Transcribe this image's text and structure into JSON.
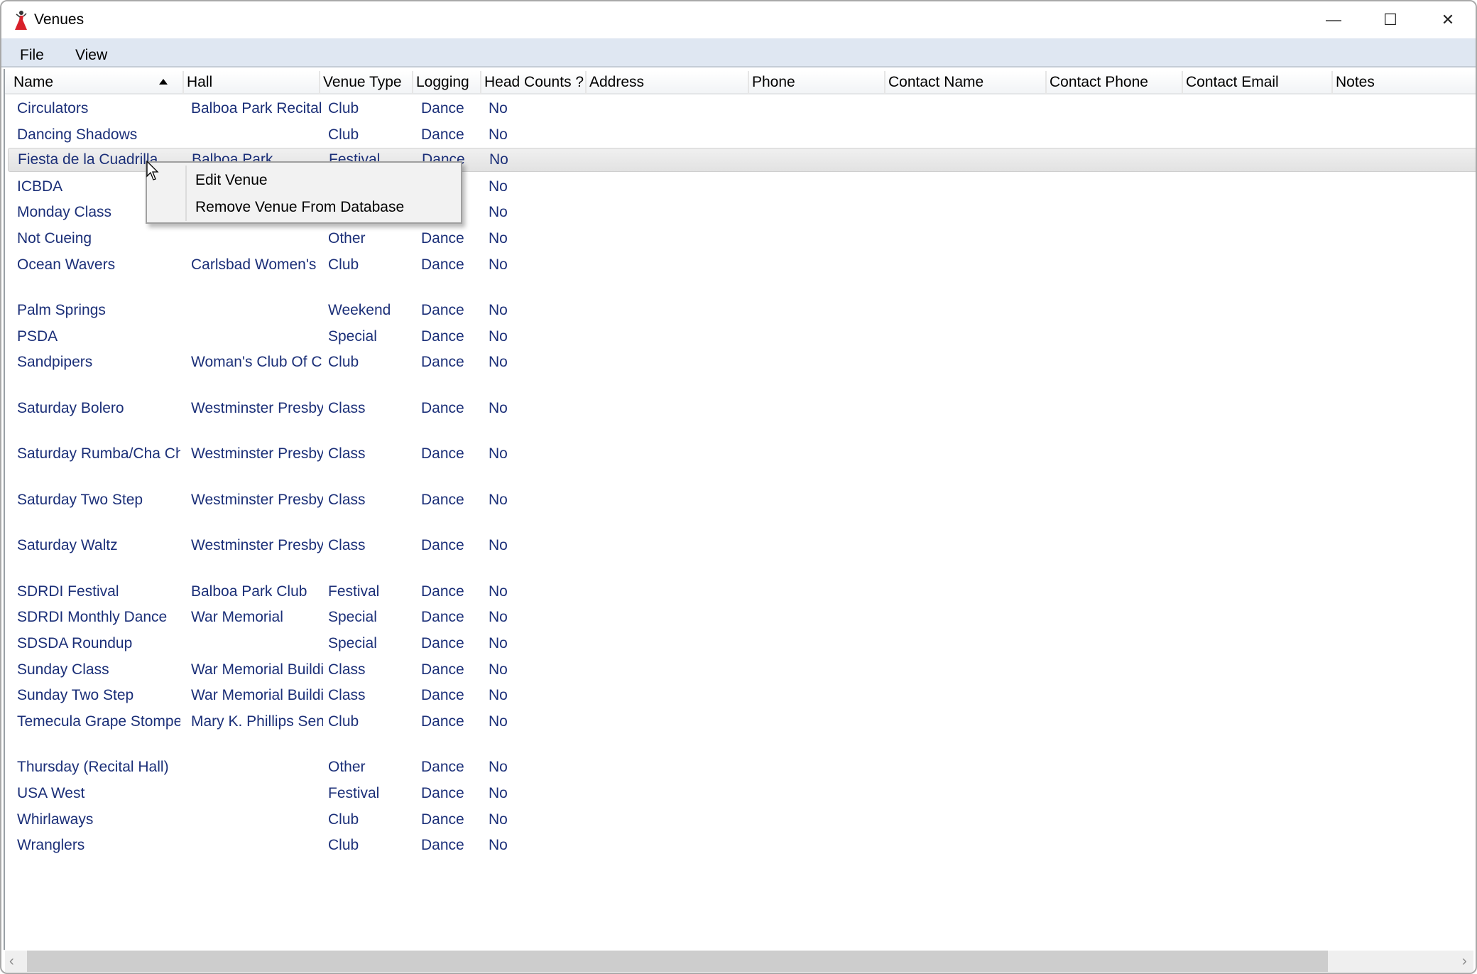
{
  "window": {
    "title": "Venues",
    "app_icon": "red-dancer-icon",
    "controls": {
      "minimize": "—",
      "maximize": "☐",
      "close": "✕"
    }
  },
  "menubar": {
    "items": [
      "File",
      "View"
    ]
  },
  "table": {
    "sort_column": "Name",
    "sort_direction": "ascending",
    "columns": [
      "Name",
      "Hall",
      "Venue Type",
      "Logging",
      "Head Counts ?",
      "Address",
      "Phone",
      "Contact Name",
      "Contact Phone",
      "Contact Email",
      "Notes"
    ],
    "selected_row": "Fiesta de la Cuadrilla",
    "rows": [
      [
        "Circulators",
        "Balboa Park Recital Hall",
        "Club",
        "Dance",
        "No"
      ],
      [
        "Dancing Shadows",
        "",
        "Club",
        "Dance",
        "No"
      ],
      [
        "Fiesta de la Cuadrilla",
        "Balboa Park",
        "Festival",
        "Dance",
        "No"
      ],
      [
        "ICBDA",
        "",
        "",
        "",
        "No"
      ],
      [
        "Monday Class",
        "",
        "",
        "",
        "No"
      ],
      [
        "Not Cueing",
        "",
        "Other",
        "Dance",
        "No"
      ],
      [
        "Ocean Wavers",
        "Carlsbad Women's",
        "Club",
        "Dance",
        "No"
      ],
      [
        "Palm Springs",
        "",
        "Weekend",
        "Dance",
        "No"
      ],
      [
        "PSDA",
        "",
        "Special",
        "Dance",
        "No"
      ],
      [
        "Sandpipers",
        "Woman's Club Of C",
        "Club",
        "Dance",
        "No"
      ],
      [
        "Saturday Bolero",
        "Westminster Presbyterian",
        "Class",
        "Dance",
        "No"
      ],
      [
        "Saturday Rumba/Cha Cha",
        "Westminster Presbyterian",
        "Class",
        "Dance",
        "No"
      ],
      [
        "Saturday Two Step",
        "Westminster Presbyterian",
        "Class",
        "Dance",
        "No"
      ],
      [
        "Saturday Waltz",
        "Westminster Presbyterian",
        "Class",
        "Dance",
        "No"
      ],
      [
        "SDRDI Festival",
        "Balboa Park Club",
        "Festival",
        "Dance",
        "No"
      ],
      [
        "SDRDI Monthly Dance",
        "War Memorial",
        "Special",
        "Dance",
        "No"
      ],
      [
        "SDSDA Roundup",
        "",
        "Special",
        "Dance",
        "No"
      ],
      [
        "Sunday Class",
        "War Memorial Building",
        "Class",
        "Dance",
        "No"
      ],
      [
        "Sunday Two Step",
        "War Memorial Building",
        "Class",
        "Dance",
        "No"
      ],
      [
        "Temecula Grape Stomper",
        "Mary K. Phillips Senior",
        "Club",
        "Dance",
        "No"
      ],
      [
        "Thursday (Recital Hall)",
        "",
        "Other",
        "Dance",
        "No"
      ],
      [
        "USA West",
        "",
        "Festival",
        "Dance",
        "No"
      ],
      [
        "Whirlaways",
        "",
        "Club",
        "Dance",
        "No"
      ],
      [
        "Wranglers",
        "",
        "Club",
        "Dance",
        "No"
      ]
    ]
  },
  "context_menu": {
    "items": [
      "Edit Venue",
      "Remove Venue From Database"
    ]
  },
  "scrollbar": {
    "left_arrow": "‹",
    "right_arrow": "›"
  },
  "colors": {
    "row_text": "#1b2f78",
    "menubar_bg": "#dfe7f2",
    "selection_bg": "#e6e6e6"
  }
}
